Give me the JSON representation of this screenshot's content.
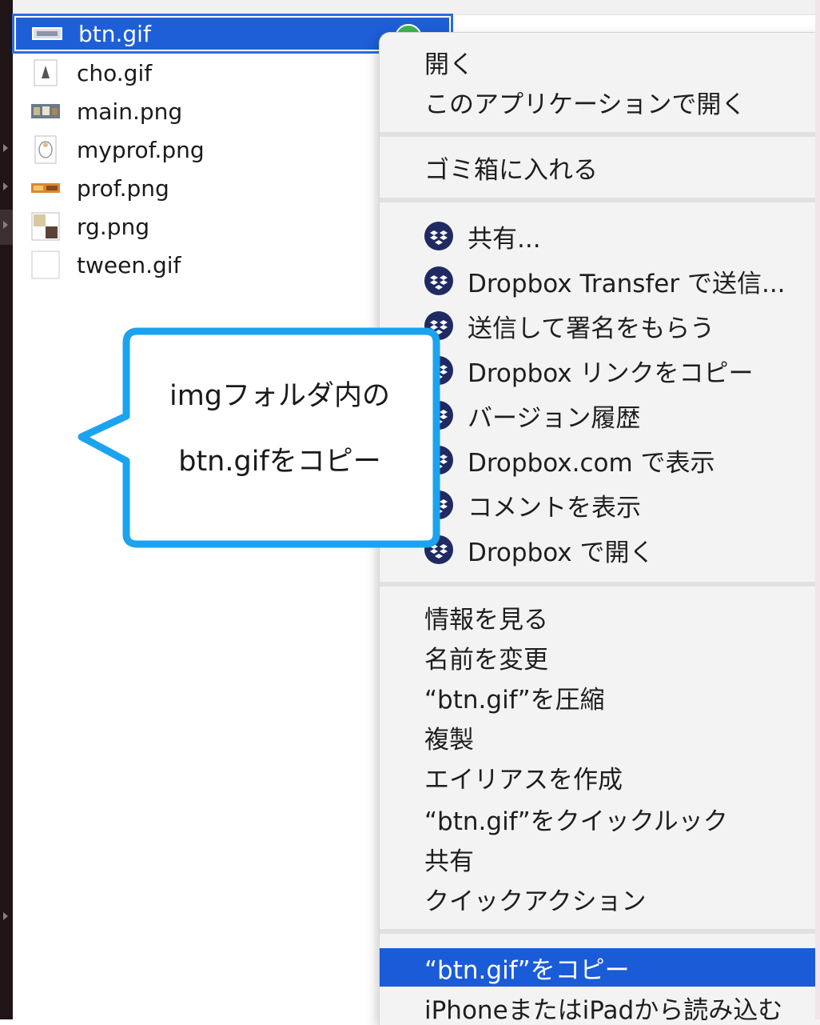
{
  "files": [
    {
      "name": "btn.gif",
      "icon": "btn-thumbnail-icon",
      "selected": true
    },
    {
      "name": "cho.gif",
      "icon": "cho-thumbnail-icon",
      "selected": false
    },
    {
      "name": "main.png",
      "icon": "main-thumbnail-icon",
      "selected": false
    },
    {
      "name": "myprof.png",
      "icon": "myprof-thumbnail-icon",
      "selected": false
    },
    {
      "name": "prof.png",
      "icon": "prof-thumbnail-icon",
      "selected": false
    },
    {
      "name": "rg.png",
      "icon": "rg-thumbnail-icon",
      "selected": false
    },
    {
      "name": "tween.gif",
      "icon": "tween-thumbnail-icon",
      "selected": false
    }
  ],
  "context_menu": {
    "items": [
      {
        "label": "開く",
        "dropbox": false
      },
      {
        "label": "このアプリケーションで開く",
        "dropbox": false
      },
      {
        "label": "ゴミ箱に入れる",
        "dropbox": false
      },
      {
        "label": "共有...",
        "dropbox": true
      },
      {
        "label": "Dropbox Transfer で送信...",
        "dropbox": true
      },
      {
        "label": "送信して署名をもらう",
        "dropbox": true
      },
      {
        "label": "Dropbox リンクをコピー",
        "dropbox": true
      },
      {
        "label": "バージョン履歴",
        "dropbox": true
      },
      {
        "label": "Dropbox.com で表示",
        "dropbox": true
      },
      {
        "label": "コメントを表示",
        "dropbox": true
      },
      {
        "label": "Dropbox で開く",
        "dropbox": true
      },
      {
        "label": "情報を見る",
        "dropbox": false
      },
      {
        "label": "名前を変更",
        "dropbox": false
      },
      {
        "label": "“btn.gif”を圧縮",
        "dropbox": false
      },
      {
        "label": "複製",
        "dropbox": false
      },
      {
        "label": "エイリアスを作成",
        "dropbox": false
      },
      {
        "label": "“btn.gif”をクイックルック",
        "dropbox": false
      },
      {
        "label": "共有",
        "dropbox": false
      },
      {
        "label": "クイックアクション",
        "dropbox": false
      },
      {
        "label": "“btn.gif”をコピー",
        "dropbox": false,
        "highlighted": true
      },
      {
        "label": "iPhoneまたはiPadから読み込む",
        "dropbox": false
      }
    ]
  },
  "callout": {
    "line1": "imgフォルダ内の",
    "line2": "btn.gifをコピー"
  },
  "colors": {
    "selection_blue": "#1e5fd7",
    "menu_highlight": "#1a5bd8",
    "callout_border": "#1aa3ee",
    "dropbox_icon": "#1f2a63"
  }
}
